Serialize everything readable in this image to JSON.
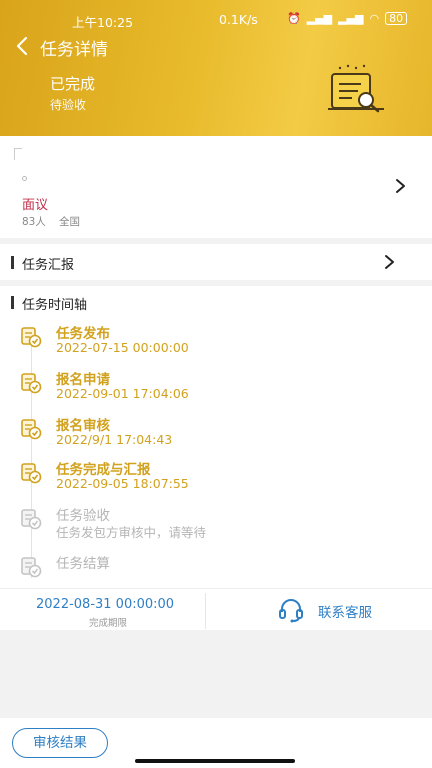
{
  "status_bar": {
    "time": "上午10:25",
    "speed": "0.1K/s",
    "icons": [
      "alarm-icon",
      "signal-icon",
      "signal-icon",
      "wifi-icon"
    ],
    "battery": "80"
  },
  "nav": {
    "title": "任务详情"
  },
  "header": {
    "state": "已完成",
    "sub_state": "待验收"
  },
  "task": {
    "name": "面议",
    "count": "83人",
    "region": "全国"
  },
  "report": {
    "title": "任务汇报"
  },
  "timeline": {
    "title": "任务时间轴",
    "items": [
      {
        "title": "任务发布",
        "sub": "2022-07-15 00:00:00",
        "status": "done"
      },
      {
        "title": "报名申请",
        "sub": "2022-09-01 17:04:06",
        "status": "done"
      },
      {
        "title": "报名审核",
        "sub": "2022/9/1 17:04:43",
        "status": "done"
      },
      {
        "title": "任务完成与汇报",
        "sub": "2022-09-05 18:07:55",
        "status": "done"
      },
      {
        "title": "任务验收",
        "sub": "任务发包方审核中，请等待",
        "status": "pending"
      },
      {
        "title": "任务结算",
        "sub": "",
        "status": "pending"
      }
    ],
    "deadline_value": "2022-08-31 00:00:00",
    "deadline_label": "完成期限",
    "customer_service_label": "联系客服"
  },
  "bottom": {
    "review_button": "审核结果"
  },
  "colors": {
    "accent_gold": "#d2a21e",
    "link_blue": "#2f7fc4",
    "task_name_red": "#c0304a"
  }
}
